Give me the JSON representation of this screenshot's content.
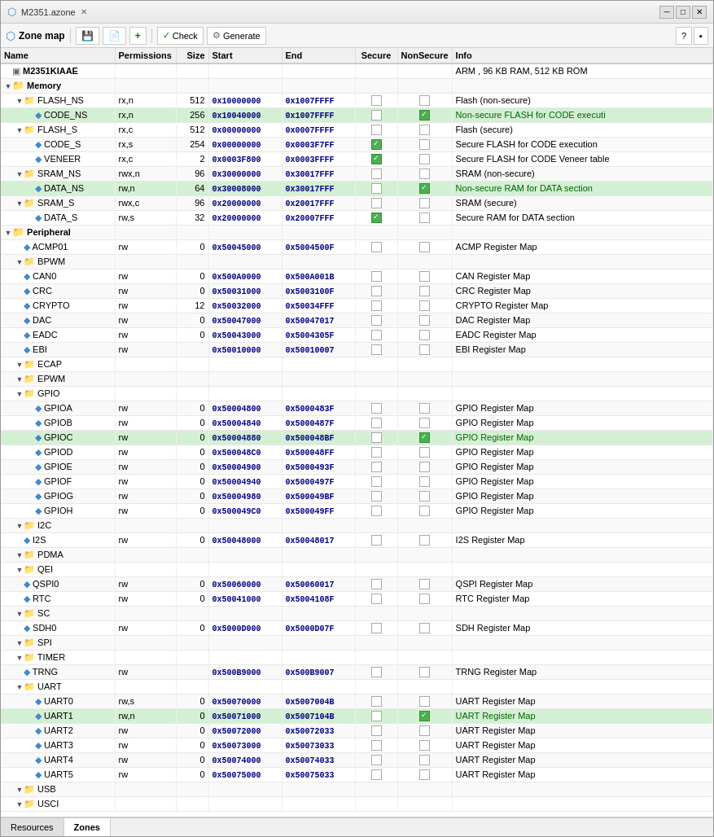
{
  "window": {
    "title": "M2351.azone",
    "tab_label": "M2351.azone"
  },
  "toolbar": {
    "zone_map_label": "Zone map",
    "btn1_icon": "save-icon",
    "btn2_icon": "add-icon",
    "check_label": "Check",
    "generate_label": "Generate",
    "help_icon": "help-icon",
    "settings_icon": "settings-icon"
  },
  "table": {
    "headers": [
      "Name",
      "Permissions",
      "Size",
      "Start",
      "End",
      "Secure",
      "NonSecure",
      "Info"
    ],
    "rows": [
      {
        "id": "m2351kiaae",
        "level": 0,
        "type": "device",
        "name": "M2351KIAAE",
        "perm": "",
        "size": "",
        "start": "",
        "end": "",
        "secure": false,
        "nonsecure": false,
        "info": "ARM , 96 KB RAM, 512 KB ROM",
        "info_type": "normal"
      },
      {
        "id": "memory",
        "level": 0,
        "type": "folder",
        "name": "Memory",
        "perm": "",
        "size": "",
        "start": "",
        "end": "",
        "secure": false,
        "nonsecure": false,
        "info": "",
        "expandable": true
      },
      {
        "id": "flash_ns",
        "level": 1,
        "type": "folder-blue",
        "name": "FLASH_NS",
        "perm": "rx,n",
        "size": "512",
        "start": "0x10000000",
        "end": "0x1007FFFF",
        "secure": false,
        "nonsecure": false,
        "info": "Flash (non-secure)",
        "info_type": "normal",
        "expandable": true
      },
      {
        "id": "code_ns",
        "level": 2,
        "type": "diamond",
        "name": "CODE_NS",
        "perm": "rx,n",
        "size": "256",
        "start": "0x10040000",
        "end": "0x1007FFFF",
        "secure": false,
        "nonsecure": true,
        "info": "Non-secure FLASH for CODE executi",
        "info_type": "green",
        "highlight": true
      },
      {
        "id": "flash_s",
        "level": 1,
        "type": "folder-blue",
        "name": "FLASH_S",
        "perm": "rx,c",
        "size": "512",
        "start": "0x00000000",
        "end": "0x0007FFFF",
        "secure": false,
        "nonsecure": false,
        "info": "Flash (secure)",
        "info_type": "normal",
        "expandable": true
      },
      {
        "id": "code_s",
        "level": 2,
        "type": "diamond",
        "name": "CODE_S",
        "perm": "rx,s",
        "size": "254",
        "start": "0x00000000",
        "end": "0x0003F7FF",
        "secure": true,
        "nonsecure": false,
        "info": "Secure FLASH for CODE execution",
        "info_type": "normal"
      },
      {
        "id": "veneer",
        "level": 2,
        "type": "diamond",
        "name": "VENEER",
        "perm": "rx,c",
        "size": "2",
        "start": "0x0003F800",
        "end": "0x0003FFFF",
        "secure": true,
        "nonsecure": false,
        "info": "Secure FLASH for CODE Veneer table",
        "info_type": "normal"
      },
      {
        "id": "sram_ns",
        "level": 1,
        "type": "folder-blue",
        "name": "SRAM_NS",
        "perm": "rwx,n",
        "size": "96",
        "start": "0x30000000",
        "end": "0x30017FFF",
        "secure": false,
        "nonsecure": false,
        "info": "SRAM (non-secure)",
        "info_type": "normal",
        "expandable": true
      },
      {
        "id": "data_ns",
        "level": 2,
        "type": "diamond",
        "name": "DATA_NS",
        "perm": "rw,n",
        "size": "64",
        "start": "0x30008000",
        "end": "0x30017FFF",
        "secure": false,
        "nonsecure": true,
        "info": "Non-secure RAM for DATA section",
        "info_type": "green",
        "highlight": true
      },
      {
        "id": "sram_s",
        "level": 1,
        "type": "folder-blue",
        "name": "SRAM_S",
        "perm": "rwx,c",
        "size": "96",
        "start": "0x20000000",
        "end": "0x20017FFF",
        "secure": false,
        "nonsecure": false,
        "info": "SRAM (secure)",
        "info_type": "normal",
        "expandable": true
      },
      {
        "id": "data_s",
        "level": 2,
        "type": "diamond",
        "name": "DATA_S",
        "perm": "rw,s",
        "size": "32",
        "start": "0x20000000",
        "end": "0x20007FFF",
        "secure": true,
        "nonsecure": false,
        "info": "Secure RAM for DATA section",
        "info_type": "normal"
      },
      {
        "id": "peripheral",
        "level": 0,
        "type": "folder",
        "name": "Peripheral",
        "perm": "",
        "size": "",
        "start": "",
        "end": "",
        "secure": false,
        "nonsecure": false,
        "info": "",
        "expandable": true
      },
      {
        "id": "acmp01",
        "level": 1,
        "type": "diamond",
        "name": "ACMP01",
        "perm": "rw",
        "size": "0",
        "start": "0x50045000",
        "end": "0x5004500F",
        "secure": false,
        "nonsecure": false,
        "info": "ACMP Register Map",
        "info_type": "normal"
      },
      {
        "id": "bpwm",
        "level": 1,
        "type": "folder-blue",
        "name": "BPWM",
        "perm": "",
        "size": "",
        "start": "",
        "end": "",
        "secure": false,
        "nonsecure": false,
        "info": "",
        "expandable": true
      },
      {
        "id": "can0",
        "level": 1,
        "type": "diamond",
        "name": "CAN0",
        "perm": "rw",
        "size": "0",
        "start": "0x500A0000",
        "end": "0x500A001B",
        "secure": false,
        "nonsecure": false,
        "info": "CAN Register Map",
        "info_type": "normal"
      },
      {
        "id": "crc",
        "level": 1,
        "type": "diamond",
        "name": "CRC",
        "perm": "rw",
        "size": "0",
        "start": "0x50031000",
        "end": "0x5003100F",
        "secure": false,
        "nonsecure": false,
        "info": "CRC Register Map",
        "info_type": "normal"
      },
      {
        "id": "crypto",
        "level": 1,
        "type": "diamond",
        "name": "CRYPTO",
        "perm": "rw",
        "size": "12",
        "start": "0x50032000",
        "end": "0x50034FFF",
        "secure": false,
        "nonsecure": false,
        "info": "CRYPTO Register Map",
        "info_type": "normal"
      },
      {
        "id": "dac",
        "level": 1,
        "type": "diamond",
        "name": "DAC",
        "perm": "rw",
        "size": "0",
        "start": "0x50047000",
        "end": "0x50047017",
        "secure": false,
        "nonsecure": false,
        "info": "DAC Register Map",
        "info_type": "normal"
      },
      {
        "id": "eadc",
        "level": 1,
        "type": "diamond",
        "name": "EADC",
        "perm": "rw",
        "size": "0",
        "start": "0x50043000",
        "end": "0x5004305F",
        "secure": false,
        "nonsecure": false,
        "info": "EADC Register Map",
        "info_type": "normal"
      },
      {
        "id": "ebi",
        "level": 1,
        "type": "diamond",
        "name": "EBI",
        "perm": "rw",
        "size": "",
        "start": "0x50010000",
        "end": "0x50010007",
        "secure": false,
        "nonsecure": false,
        "info": "EBI Register Map",
        "info_type": "normal"
      },
      {
        "id": "ecap",
        "level": 1,
        "type": "folder-blue",
        "name": "ECAP",
        "perm": "",
        "size": "",
        "start": "",
        "end": "",
        "secure": false,
        "nonsecure": false,
        "info": "",
        "expandable": true
      },
      {
        "id": "epwm",
        "level": 1,
        "type": "folder-blue",
        "name": "EPWM",
        "perm": "",
        "size": "",
        "start": "",
        "end": "",
        "secure": false,
        "nonsecure": false,
        "info": "",
        "expandable": true
      },
      {
        "id": "gpio",
        "level": 1,
        "type": "folder-blue",
        "name": "GPIO",
        "perm": "",
        "size": "",
        "start": "",
        "end": "",
        "secure": false,
        "nonsecure": false,
        "info": "",
        "expandable": true
      },
      {
        "id": "gpioa",
        "level": 2,
        "type": "diamond",
        "name": "GPIOA",
        "perm": "rw",
        "size": "0",
        "start": "0x50004800",
        "end": "0x5000483F",
        "secure": false,
        "nonsecure": false,
        "info": "GPIO Register Map",
        "info_type": "normal"
      },
      {
        "id": "gpiob",
        "level": 2,
        "type": "diamond",
        "name": "GPIOB",
        "perm": "rw",
        "size": "0",
        "start": "0x50004840",
        "end": "0x5000487F",
        "secure": false,
        "nonsecure": false,
        "info": "GPIO Register Map",
        "info_type": "normal"
      },
      {
        "id": "gpioc",
        "level": 2,
        "type": "diamond",
        "name": "GPIOC",
        "perm": "rw",
        "size": "0",
        "start": "0x50004880",
        "end": "0x500048BF",
        "secure": false,
        "nonsecure": true,
        "info": "GPIO Register Map",
        "info_type": "green",
        "highlight": true
      },
      {
        "id": "gpiod",
        "level": 2,
        "type": "diamond",
        "name": "GPIOD",
        "perm": "rw",
        "size": "0",
        "start": "0x500048C0",
        "end": "0x500048FF",
        "secure": false,
        "nonsecure": false,
        "info": "GPIO Register Map",
        "info_type": "normal"
      },
      {
        "id": "gpioe",
        "level": 2,
        "type": "diamond",
        "name": "GPIOE",
        "perm": "rw",
        "size": "0",
        "start": "0x50004900",
        "end": "0x5000493F",
        "secure": false,
        "nonsecure": false,
        "info": "GPIO Register Map",
        "info_type": "normal"
      },
      {
        "id": "gpiof",
        "level": 2,
        "type": "diamond",
        "name": "GPIOF",
        "perm": "rw",
        "size": "0",
        "start": "0x50004940",
        "end": "0x5000497F",
        "secure": false,
        "nonsecure": false,
        "info": "GPIO Register Map",
        "info_type": "normal"
      },
      {
        "id": "gpiog",
        "level": 2,
        "type": "diamond",
        "name": "GPIOG",
        "perm": "rw",
        "size": "0",
        "start": "0x50004980",
        "end": "0x500049BF",
        "secure": false,
        "nonsecure": false,
        "info": "GPIO Register Map",
        "info_type": "normal"
      },
      {
        "id": "gpioh",
        "level": 2,
        "type": "diamond",
        "name": "GPIOH",
        "perm": "rw",
        "size": "0",
        "start": "0x500049C0",
        "end": "0x500049FF",
        "secure": false,
        "nonsecure": false,
        "info": "GPIO Register Map",
        "info_type": "normal"
      },
      {
        "id": "i2c",
        "level": 1,
        "type": "folder-blue",
        "name": "I2C",
        "perm": "",
        "size": "",
        "start": "",
        "end": "",
        "secure": false,
        "nonsecure": false,
        "info": "",
        "expandable": true
      },
      {
        "id": "i2s",
        "level": 1,
        "type": "diamond",
        "name": "I2S",
        "perm": "rw",
        "size": "0",
        "start": "0x50048000",
        "end": "0x50048017",
        "secure": false,
        "nonsecure": false,
        "info": "I2S Register Map",
        "info_type": "normal"
      },
      {
        "id": "pdma",
        "level": 1,
        "type": "folder-blue",
        "name": "PDMA",
        "perm": "",
        "size": "",
        "start": "",
        "end": "",
        "secure": false,
        "nonsecure": false,
        "info": "",
        "expandable": true
      },
      {
        "id": "qei",
        "level": 1,
        "type": "folder-blue",
        "name": "QEI",
        "perm": "",
        "size": "",
        "start": "",
        "end": "",
        "secure": false,
        "nonsecure": false,
        "info": "",
        "expandable": true
      },
      {
        "id": "qspi0",
        "level": 1,
        "type": "diamond",
        "name": "QSPI0",
        "perm": "rw",
        "size": "0",
        "start": "0x50060000",
        "end": "0x50060017",
        "secure": false,
        "nonsecure": false,
        "info": "QSPI Register Map",
        "info_type": "normal"
      },
      {
        "id": "rtc",
        "level": 1,
        "type": "diamond",
        "name": "RTC",
        "perm": "rw",
        "size": "0",
        "start": "0x50041000",
        "end": "0x5004108F",
        "secure": false,
        "nonsecure": false,
        "info": "RTC Register Map",
        "info_type": "normal"
      },
      {
        "id": "sc",
        "level": 1,
        "type": "folder-blue",
        "name": "SC",
        "perm": "",
        "size": "",
        "start": "",
        "end": "",
        "secure": false,
        "nonsecure": false,
        "info": "",
        "expandable": true
      },
      {
        "id": "sdh0",
        "level": 1,
        "type": "diamond",
        "name": "SDH0",
        "perm": "rw",
        "size": "0",
        "start": "0x5000D000",
        "end": "0x5000D07F",
        "secure": false,
        "nonsecure": false,
        "info": "SDH Register Map",
        "info_type": "normal"
      },
      {
        "id": "spi",
        "level": 1,
        "type": "folder-blue",
        "name": "SPI",
        "perm": "",
        "size": "",
        "start": "",
        "end": "",
        "secure": false,
        "nonsecure": false,
        "info": "",
        "expandable": true
      },
      {
        "id": "timer",
        "level": 1,
        "type": "folder-blue",
        "name": "TIMER",
        "perm": "",
        "size": "",
        "start": "",
        "end": "",
        "secure": false,
        "nonsecure": false,
        "info": "",
        "expandable": true
      },
      {
        "id": "trng",
        "level": 1,
        "type": "diamond",
        "name": "TRNG",
        "perm": "rw",
        "size": "",
        "start": "0x500B9000",
        "end": "0x500B9007",
        "secure": false,
        "nonsecure": false,
        "info": "TRNG Register Map",
        "info_type": "normal"
      },
      {
        "id": "uart",
        "level": 1,
        "type": "folder-blue",
        "name": "UART",
        "perm": "",
        "size": "",
        "start": "",
        "end": "",
        "secure": false,
        "nonsecure": false,
        "info": "",
        "expandable": true
      },
      {
        "id": "uart0",
        "level": 2,
        "type": "diamond",
        "name": "UART0",
        "perm": "rw,s",
        "size": "0",
        "start": "0x50070000",
        "end": "0x5007004B",
        "secure": false,
        "nonsecure": false,
        "info": "UART Register Map",
        "info_type": "normal"
      },
      {
        "id": "uart1",
        "level": 2,
        "type": "diamond",
        "name": "UART1",
        "perm": "rw,n",
        "size": "0",
        "start": "0x50071000",
        "end": "0x5007104B",
        "secure": false,
        "nonsecure": true,
        "info": "UART Register Map",
        "info_type": "green",
        "highlight": true
      },
      {
        "id": "uart2",
        "level": 2,
        "type": "diamond",
        "name": "UART2",
        "perm": "rw",
        "size": "0",
        "start": "0x50072000",
        "end": "0x50072033",
        "secure": false,
        "nonsecure": false,
        "info": "UART Register Map",
        "info_type": "normal"
      },
      {
        "id": "uart3",
        "level": 2,
        "type": "diamond",
        "name": "UART3",
        "perm": "rw",
        "size": "0",
        "start": "0x50073000",
        "end": "0x50073033",
        "secure": false,
        "nonsecure": false,
        "info": "UART Register Map",
        "info_type": "normal"
      },
      {
        "id": "uart4",
        "level": 2,
        "type": "diamond",
        "name": "UART4",
        "perm": "rw",
        "size": "0",
        "start": "0x50074000",
        "end": "0x50074033",
        "secure": false,
        "nonsecure": false,
        "info": "UART Register Map",
        "info_type": "normal"
      },
      {
        "id": "uart5",
        "level": 2,
        "type": "diamond",
        "name": "UART5",
        "perm": "rw",
        "size": "0",
        "start": "0x50075000",
        "end": "0x50075033",
        "secure": false,
        "nonsecure": false,
        "info": "UART Register Map",
        "info_type": "normal"
      },
      {
        "id": "usb",
        "level": 1,
        "type": "folder-blue",
        "name": "USB",
        "perm": "",
        "size": "",
        "start": "",
        "end": "",
        "secure": false,
        "nonsecure": false,
        "info": "",
        "expandable": true
      },
      {
        "id": "usci",
        "level": 1,
        "type": "folder-blue",
        "name": "USCI",
        "perm": "",
        "size": "",
        "start": "",
        "end": "",
        "secure": false,
        "nonsecure": false,
        "info": "",
        "expandable": true
      }
    ]
  },
  "bottom_tabs": [
    {
      "label": "Resources",
      "active": false
    },
    {
      "label": "Zones",
      "active": true
    }
  ]
}
